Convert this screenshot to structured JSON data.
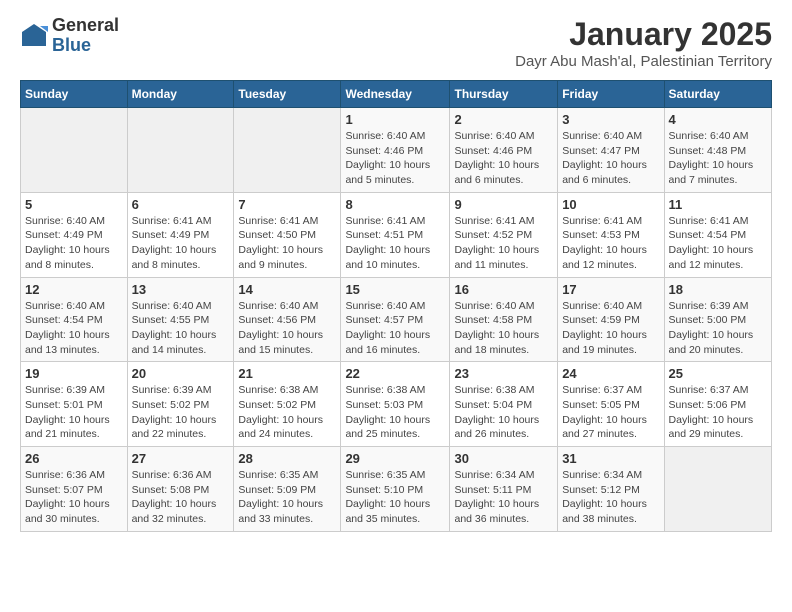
{
  "logo": {
    "general": "General",
    "blue": "Blue"
  },
  "title": "January 2025",
  "subtitle": "Dayr Abu Mash'al, Palestinian Territory",
  "headers": [
    "Sunday",
    "Monday",
    "Tuesday",
    "Wednesday",
    "Thursday",
    "Friday",
    "Saturday"
  ],
  "weeks": [
    [
      {
        "num": "",
        "info": ""
      },
      {
        "num": "",
        "info": ""
      },
      {
        "num": "",
        "info": ""
      },
      {
        "num": "1",
        "info": "Sunrise: 6:40 AM\nSunset: 4:46 PM\nDaylight: 10 hours\nand 5 minutes."
      },
      {
        "num": "2",
        "info": "Sunrise: 6:40 AM\nSunset: 4:46 PM\nDaylight: 10 hours\nand 6 minutes."
      },
      {
        "num": "3",
        "info": "Sunrise: 6:40 AM\nSunset: 4:47 PM\nDaylight: 10 hours\nand 6 minutes."
      },
      {
        "num": "4",
        "info": "Sunrise: 6:40 AM\nSunset: 4:48 PM\nDaylight: 10 hours\nand 7 minutes."
      }
    ],
    [
      {
        "num": "5",
        "info": "Sunrise: 6:40 AM\nSunset: 4:49 PM\nDaylight: 10 hours\nand 8 minutes."
      },
      {
        "num": "6",
        "info": "Sunrise: 6:41 AM\nSunset: 4:49 PM\nDaylight: 10 hours\nand 8 minutes."
      },
      {
        "num": "7",
        "info": "Sunrise: 6:41 AM\nSunset: 4:50 PM\nDaylight: 10 hours\nand 9 minutes."
      },
      {
        "num": "8",
        "info": "Sunrise: 6:41 AM\nSunset: 4:51 PM\nDaylight: 10 hours\nand 10 minutes."
      },
      {
        "num": "9",
        "info": "Sunrise: 6:41 AM\nSunset: 4:52 PM\nDaylight: 10 hours\nand 11 minutes."
      },
      {
        "num": "10",
        "info": "Sunrise: 6:41 AM\nSunset: 4:53 PM\nDaylight: 10 hours\nand 12 minutes."
      },
      {
        "num": "11",
        "info": "Sunrise: 6:41 AM\nSunset: 4:54 PM\nDaylight: 10 hours\nand 12 minutes."
      }
    ],
    [
      {
        "num": "12",
        "info": "Sunrise: 6:40 AM\nSunset: 4:54 PM\nDaylight: 10 hours\nand 13 minutes."
      },
      {
        "num": "13",
        "info": "Sunrise: 6:40 AM\nSunset: 4:55 PM\nDaylight: 10 hours\nand 14 minutes."
      },
      {
        "num": "14",
        "info": "Sunrise: 6:40 AM\nSunset: 4:56 PM\nDaylight: 10 hours\nand 15 minutes."
      },
      {
        "num": "15",
        "info": "Sunrise: 6:40 AM\nSunset: 4:57 PM\nDaylight: 10 hours\nand 16 minutes."
      },
      {
        "num": "16",
        "info": "Sunrise: 6:40 AM\nSunset: 4:58 PM\nDaylight: 10 hours\nand 18 minutes."
      },
      {
        "num": "17",
        "info": "Sunrise: 6:40 AM\nSunset: 4:59 PM\nDaylight: 10 hours\nand 19 minutes."
      },
      {
        "num": "18",
        "info": "Sunrise: 6:39 AM\nSunset: 5:00 PM\nDaylight: 10 hours\nand 20 minutes."
      }
    ],
    [
      {
        "num": "19",
        "info": "Sunrise: 6:39 AM\nSunset: 5:01 PM\nDaylight: 10 hours\nand 21 minutes."
      },
      {
        "num": "20",
        "info": "Sunrise: 6:39 AM\nSunset: 5:02 PM\nDaylight: 10 hours\nand 22 minutes."
      },
      {
        "num": "21",
        "info": "Sunrise: 6:38 AM\nSunset: 5:02 PM\nDaylight: 10 hours\nand 24 minutes."
      },
      {
        "num": "22",
        "info": "Sunrise: 6:38 AM\nSunset: 5:03 PM\nDaylight: 10 hours\nand 25 minutes."
      },
      {
        "num": "23",
        "info": "Sunrise: 6:38 AM\nSunset: 5:04 PM\nDaylight: 10 hours\nand 26 minutes."
      },
      {
        "num": "24",
        "info": "Sunrise: 6:37 AM\nSunset: 5:05 PM\nDaylight: 10 hours\nand 27 minutes."
      },
      {
        "num": "25",
        "info": "Sunrise: 6:37 AM\nSunset: 5:06 PM\nDaylight: 10 hours\nand 29 minutes."
      }
    ],
    [
      {
        "num": "26",
        "info": "Sunrise: 6:36 AM\nSunset: 5:07 PM\nDaylight: 10 hours\nand 30 minutes."
      },
      {
        "num": "27",
        "info": "Sunrise: 6:36 AM\nSunset: 5:08 PM\nDaylight: 10 hours\nand 32 minutes."
      },
      {
        "num": "28",
        "info": "Sunrise: 6:35 AM\nSunset: 5:09 PM\nDaylight: 10 hours\nand 33 minutes."
      },
      {
        "num": "29",
        "info": "Sunrise: 6:35 AM\nSunset: 5:10 PM\nDaylight: 10 hours\nand 35 minutes."
      },
      {
        "num": "30",
        "info": "Sunrise: 6:34 AM\nSunset: 5:11 PM\nDaylight: 10 hours\nand 36 minutes."
      },
      {
        "num": "31",
        "info": "Sunrise: 6:34 AM\nSunset: 5:12 PM\nDaylight: 10 hours\nand 38 minutes."
      },
      {
        "num": "",
        "info": ""
      }
    ]
  ]
}
